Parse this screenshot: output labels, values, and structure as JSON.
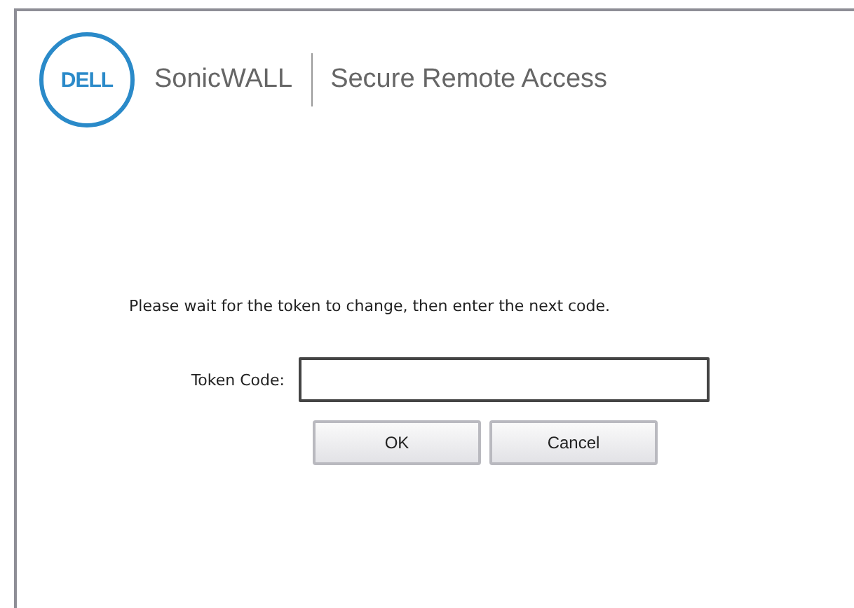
{
  "header": {
    "logo": "DELL",
    "brand": "SonicWALL",
    "product": "Secure Remote Access"
  },
  "message": "Please wait for the token to change, then enter the next code.",
  "token_field": {
    "label": "Token Code:"
  },
  "buttons": [
    "OK",
    "Cancel"
  ]
}
